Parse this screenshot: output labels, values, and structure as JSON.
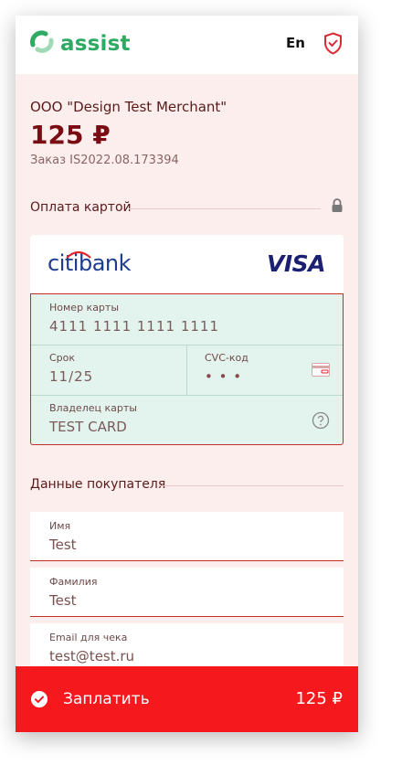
{
  "header": {
    "logo_text": "assist",
    "language": "En"
  },
  "order": {
    "merchant": "ООО \"Design Test Merchant\"",
    "amount": "125 ₽",
    "order_number": "Заказ IS2022.08.173394"
  },
  "card_section": {
    "title": "Оплата картой",
    "bank": "citibank",
    "bank_part1": "citi",
    "bank_part2": "bank",
    "network": "VISA",
    "card_number_label": "Номер карты",
    "card_number_value": "4111 1111 1111 1111",
    "expiry_label": "Срок",
    "expiry_value": "11/25",
    "cvc_label": "CVC-код",
    "cvc_value": "• • •",
    "holder_label": "Владелец карты",
    "holder_value": "TEST CARD"
  },
  "buyer_section": {
    "title": "Данные покупателя",
    "fields": [
      {
        "label": "Имя",
        "value": "Test"
      },
      {
        "label": "Фамилия",
        "value": "Test"
      },
      {
        "label": "Email для чека",
        "value": "test@test.ru"
      }
    ]
  },
  "pay_button": {
    "label": "Заплатить",
    "amount": "125 ₽"
  },
  "colors": {
    "accent_red": "#f5191e",
    "brand_green": "#2eaa63",
    "page_bg": "#fdeeee",
    "card_form_bg": "#e3f3ee"
  },
  "icons": [
    "assist-logo-icon",
    "shield-check-icon",
    "lock-icon",
    "cvc-card-icon",
    "help-icon",
    "check-circle-icon"
  ]
}
